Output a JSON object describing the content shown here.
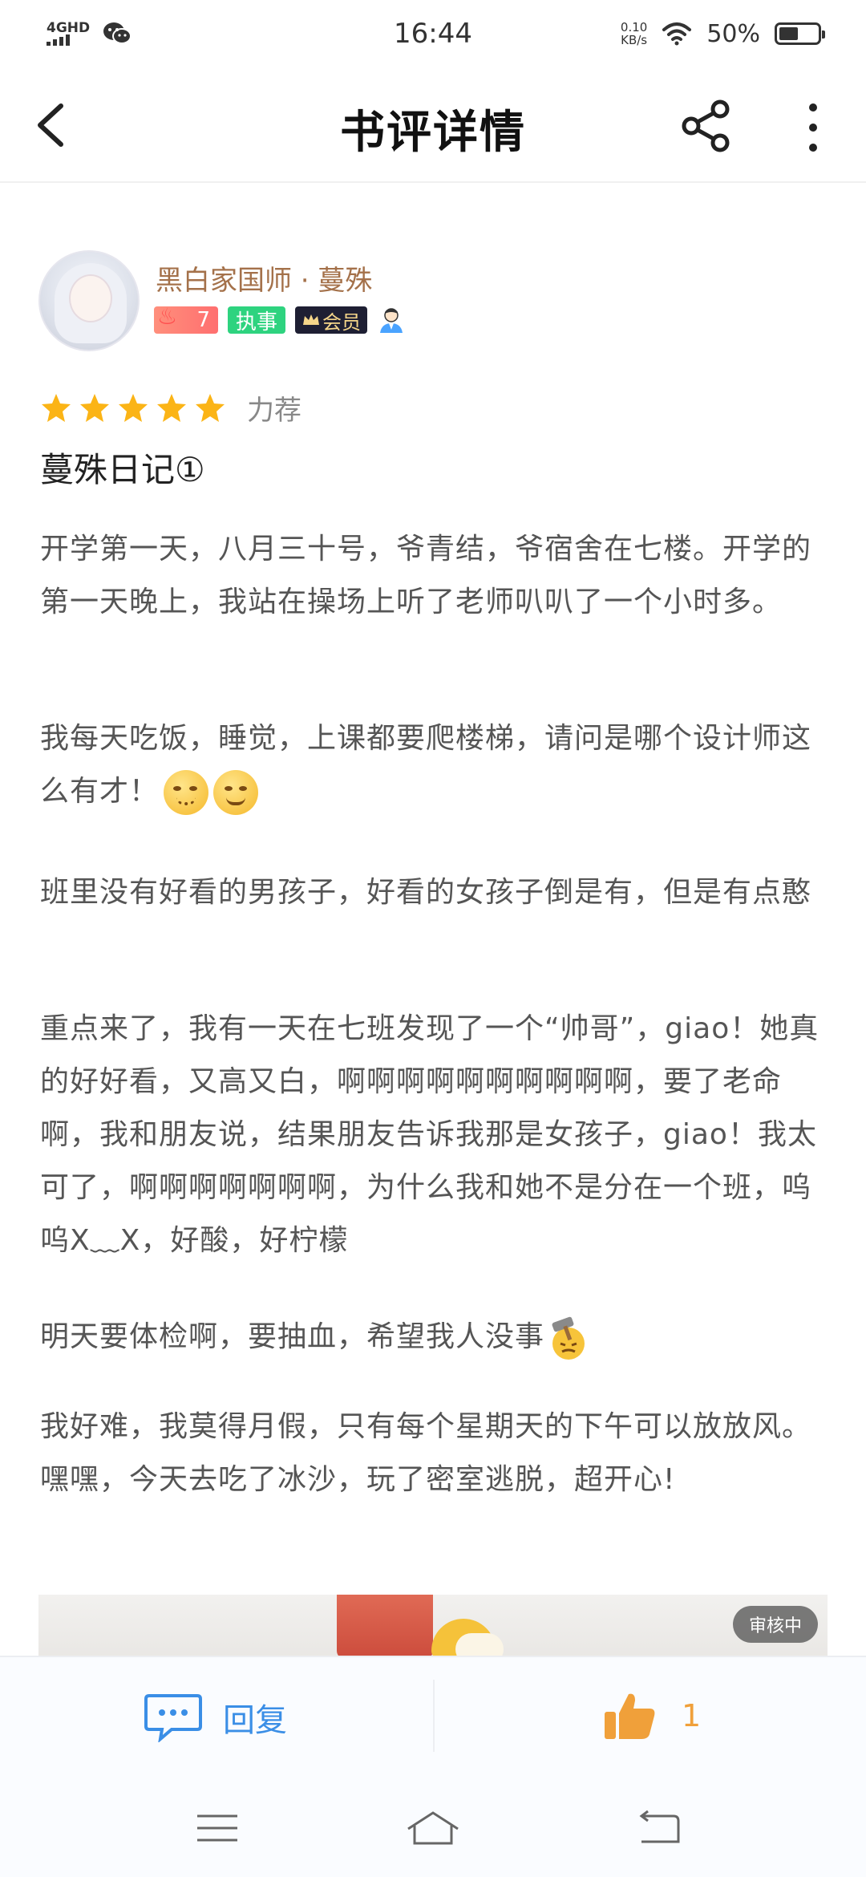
{
  "status_bar": {
    "network": "4GHD",
    "time": "16:44",
    "speed_value": "0.10",
    "speed_unit": "KB/s",
    "battery_text": "50%",
    "battery_level": 0.5
  },
  "header": {
    "title": "书评详情"
  },
  "author": {
    "name": "黑白家国师 · 蔓殊",
    "level": "7",
    "role_badge": "执事",
    "vip_badge": "会员"
  },
  "rating": {
    "stars": 5,
    "label": "力荐"
  },
  "review": {
    "title": "蔓殊日记①",
    "p1": "开学第一天，八月三十号，爷青结，爷宿舍在七楼。开学的第一天晚上，我站在操场上听了老师叭叭了一个小时多。",
    "p2": "我每天吃饭，睡觉，上课都要爬楼梯，请问是哪个设计师这么有才！",
    "p3": "班里没有好看的男孩子，好看的女孩子倒是有，但是有点憨",
    "p4": "重点来了，我有一天在七班发现了一个“帅哥”，giao！她真的好好看，又高又白，啊啊啊啊啊啊啊啊啊啊，要了老命啊，我和朋友说，结果朋友告诉我那是女孩子，giao！我太可了，啊啊啊啊啊啊啊，为什么我和她不是分在一个班，呜呜X﹏X，好酸，好柠檬",
    "p5": "明天要体检啊，要抽血，希望我人没事",
    "p6": "我好难，我莫得月假，只有每个星期天的下午可以放放风。嘿嘿，今天去吃了冰沙，玩了密室逃脱，超开心!",
    "image_badge": "审核中"
  },
  "actions": {
    "reply_label": "回复",
    "like_count": "1"
  },
  "colors": {
    "accent_blue": "#3a8ee6",
    "like_orange": "#f0a03a",
    "author_brown": "#a4714a",
    "star": "#fbb416"
  }
}
